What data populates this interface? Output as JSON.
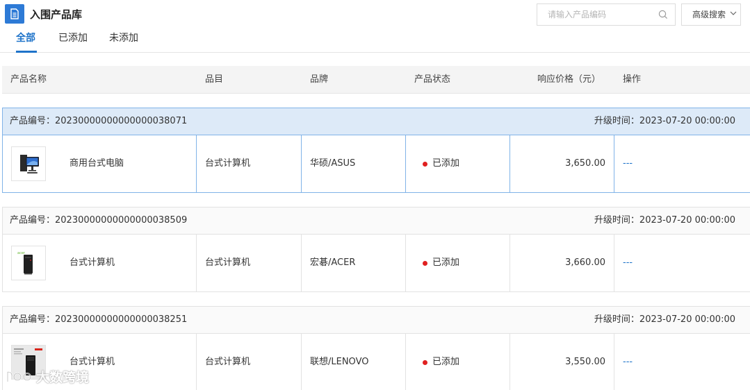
{
  "header": {
    "title": "入围产品库",
    "title_icon": "document-icon",
    "search_placeholder": "请输入产品编码",
    "advanced_search_label": "高级搜索"
  },
  "tabs": [
    {
      "label": "全部",
      "active": true
    },
    {
      "label": "已添加",
      "active": false
    },
    {
      "label": "未添加",
      "active": false
    }
  ],
  "columns": {
    "name": "产品名称",
    "category": "品目",
    "brand": "品牌",
    "status": "产品状态",
    "price": "响应价格（元）",
    "action": "操作"
  },
  "groups": [
    {
      "code_label": "产品编号：20230000000000000038071",
      "time_label": "升级时间：2023-07-20 00:00:00",
      "selected": true,
      "product": {
        "image": "desktop-computer-monitor-image",
        "name": "商用台式电脑",
        "category": "台式计算机",
        "brand": "华硕/ASUS",
        "status": "已添加",
        "price": "3,650.00",
        "action": "---"
      }
    },
    {
      "code_label": "产品编号：20230000000000000038509",
      "time_label": "升级时间：2023-07-20 00:00:00",
      "selected": false,
      "product": {
        "image": "acer-tower-pc-image",
        "name": "台式计算机",
        "category": "台式计算机",
        "brand": "宏碁/ACER",
        "status": "已添加",
        "price": "3,660.00",
        "action": "---"
      }
    },
    {
      "code_label": "产品编号：20230000000000000038251",
      "time_label": "升级时间：2023-07-20 00:00:00",
      "selected": false,
      "product": {
        "image": "lenovo-tower-pc-image",
        "name": "台式计算机",
        "category": "台式计算机",
        "brand": "联想/LENOVO",
        "status": "已添加",
        "price": "3,550.00",
        "action": "---"
      }
    }
  ],
  "watermark": {
    "text": "大数跨境",
    "logo": "watermark-logo"
  },
  "colors": {
    "accent": "#1e73c9",
    "title_icon_bg": "#2d7ad6",
    "selected_row_bg": "#ddeaf8",
    "selected_border": "#80b3e8",
    "status_dot": "#e02020"
  }
}
